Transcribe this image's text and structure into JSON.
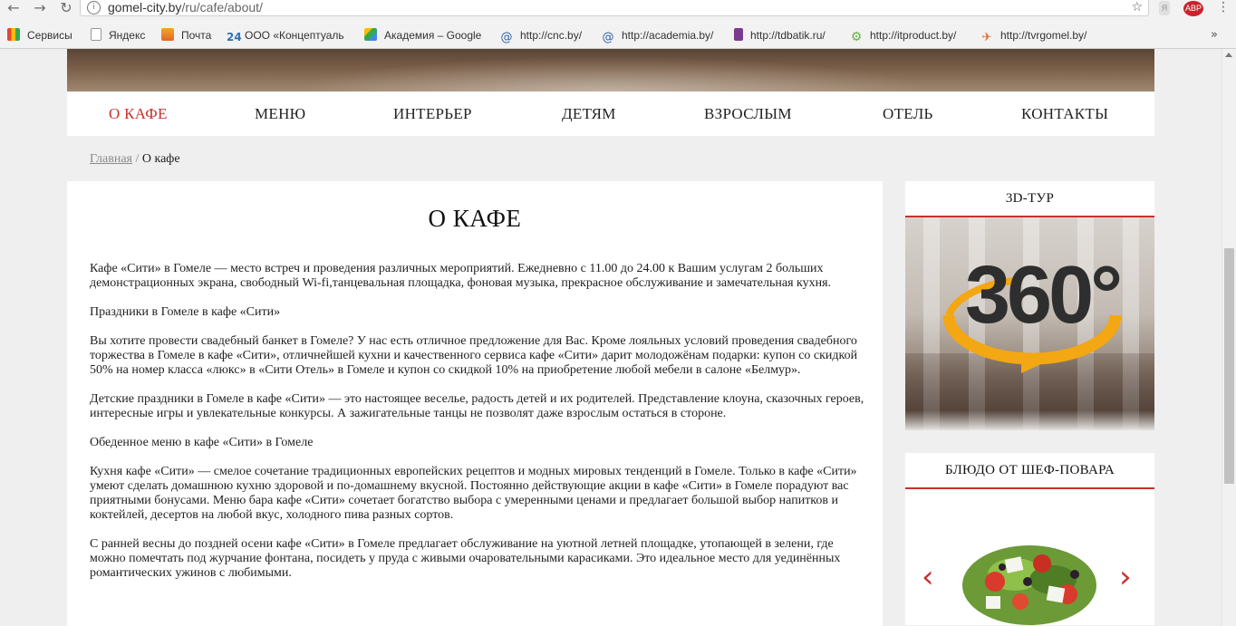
{
  "browser": {
    "url_host": "gomel-city.by",
    "url_path": "/ru/cafe/about/",
    "ext_label": "ABP",
    "bookmarks": [
      {
        "label": "Сервисы",
        "icon": "apps-icon"
      },
      {
        "label": "Яндекс",
        "icon": "page-icon"
      },
      {
        "label": "Почта",
        "icon": "mail-icon"
      },
      {
        "label": "ООО «Концептуаль",
        "icon": "number-24-icon",
        "icon_text": "24"
      },
      {
        "label": "Академия – Google",
        "icon": "google-drive-icon"
      },
      {
        "label": "http://cnc.by/",
        "icon": "swirl-icon"
      },
      {
        "label": "http://academia.by/",
        "icon": "swirl-icon"
      },
      {
        "label": "http://tdbatik.ru/",
        "icon": "b-logo-icon"
      },
      {
        "label": "http://itproduct.by/",
        "icon": "gear-icon"
      },
      {
        "label": "http://tvrgomel.by/",
        "icon": "tv-icon"
      }
    ]
  },
  "nav": {
    "items": [
      "О КАФЕ",
      "МЕНЮ",
      "ИНТЕРЬЕР",
      "ДЕТЯМ",
      "ВЗРОСЛЫМ",
      "ОТЕЛЬ",
      "КОНТАКТЫ"
    ]
  },
  "breadcrumb": {
    "home": "Главная",
    "separator": "/",
    "current": "О кафе"
  },
  "content": {
    "title": "О КАФЕ",
    "paragraphs": [
      "Кафе «Сити» в Гомеле — место встреч и проведения различных мероприятий. Ежедневно с 11.00 до 24.00 к Вашим услугам 2 больших демонстрационных экрана,  свободный Wi-fi,танцевальная площадка, фоновая музыка, прекрасное обслуживание и замечательная кухня.",
      "Праздники в Гомеле в кафе «Сити»",
      "Вы хотите провести свадебный банкет в Гомеле? У нас есть отличное предложение для Вас. Кроме лояльных условий проведения свадебного торжества в Гомеле в кафе «Сити», отличнейшей кухни и качественного сервиса кафе «Сити» дарит молодожёнам подарки: купон со скидкой 50% на номер класса «люкс» в «Сити Отель» в Гомеле и купон со скидкой 10% на приобретение любой мебели в салоне «Белмур».",
      "Детские праздники в Гомеле в кафе «Сити» — это настоящее веселье, радость детей и их родителей. Представление клоуна, сказочных героев, интересные игры и увлекательные конкурсы. А зажигательные танцы не позволят даже взрослым остаться в стороне.",
      "Обеденное меню в кафе «Сити» в Гомеле",
      "Кухня кафе «Сити» — смелое сочетание традиционных европейских рецептов и модных мировых тенденций в Гомеле. Только в кафе «Сити» умеют сделать домашнюю кухню здоровой и по-домашнему вкусной.  Постоянно действующие акции в кафе «Сити» в Гомеле порадуют вас приятными бонусами. Меню бара кафе «Сити» сочетает богатство выбора с умеренными ценами и предлагает большой выбор напитков и коктейлей, десертов на любой вкус, холодного пива разных сортов.",
      "С ранней весны до поздней осени кафе «Сити» в Гомеле предлагает обслуживание на уютной летней площадке, утопающей в зелени, где можно помечтать под журчание фонтана, посидеть у пруда с живыми очаровательными карасиками. Это идеальное место для уединённых романтических ужинов с любимыми."
    ]
  },
  "sidebar": {
    "tour_title": "3D-ТУР",
    "tour_badge": "360°",
    "chef_title": "БЛЮДО ОТ ШЕФ-ПОВАРА"
  },
  "colors": {
    "accent": "#c9302c",
    "page_bg": "#efefef"
  }
}
